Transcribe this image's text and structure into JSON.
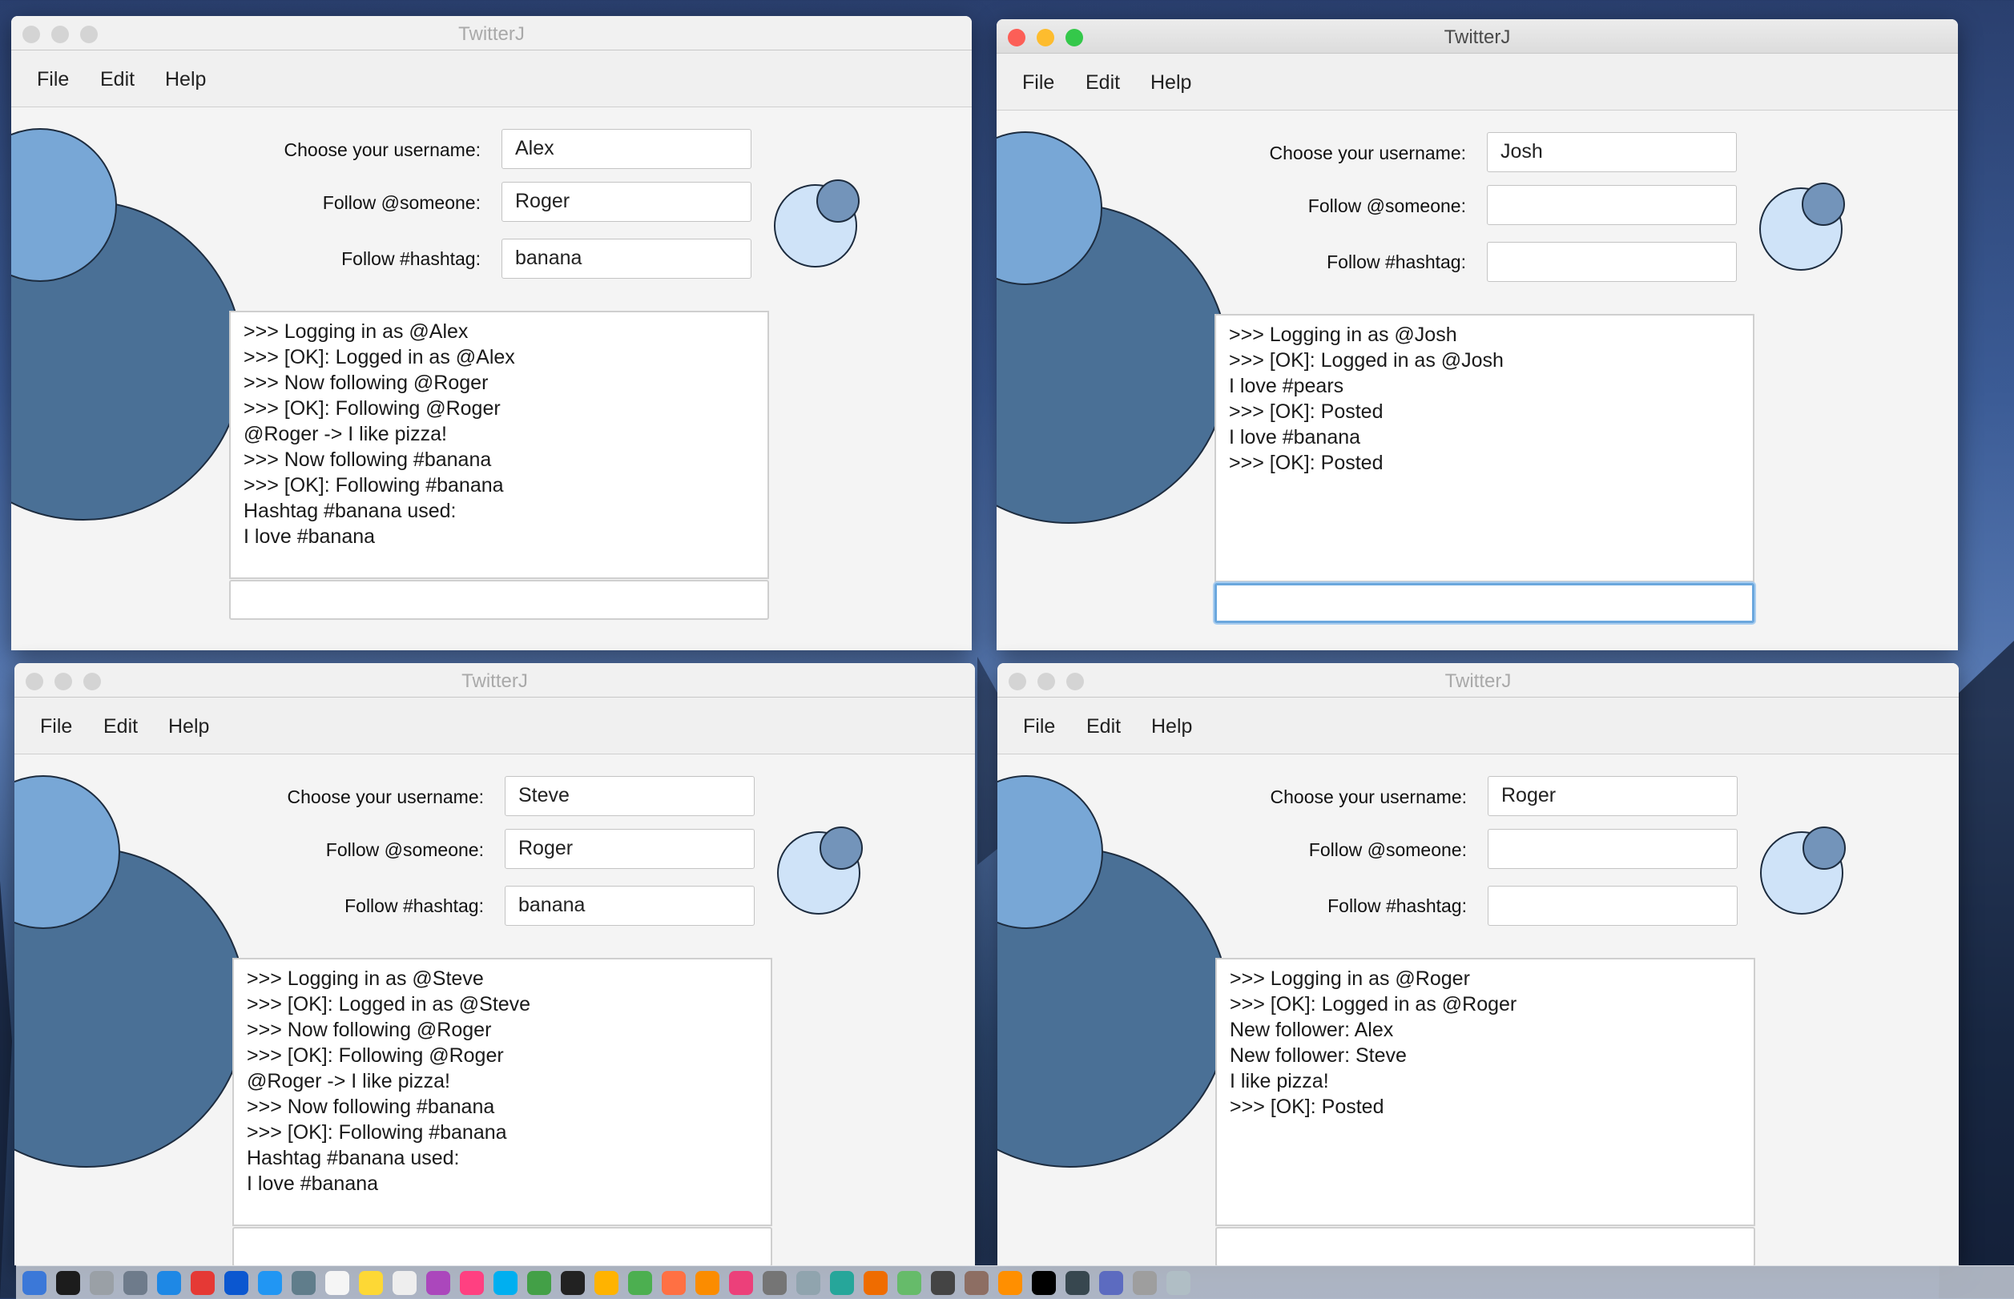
{
  "windows": [
    {
      "id": "alex",
      "title": "TwitterJ",
      "active": false,
      "menu": [
        "File",
        "Edit",
        "Help"
      ],
      "labels": {
        "username": "Choose your username:",
        "follow_user": "Follow @someone:",
        "follow_tag": "Follow #hashtag:"
      },
      "fields": {
        "username": "Alex",
        "follow_user": "Roger",
        "follow_tag": "banana"
      },
      "log": [
        ">>> Logging in as @Alex",
        ">>> [OK]: Logged in as @Alex",
        ">>> Now following @Roger",
        ">>> [OK]: Following @Roger",
        "@Roger -> I like pizza!",
        ">>> Now following #banana",
        ">>> [OK]: Following #banana",
        "Hashtag #banana used:",
        "I love #banana"
      ],
      "message": ""
    },
    {
      "id": "josh",
      "title": "TwitterJ",
      "active": true,
      "menu": [
        "File",
        "Edit",
        "Help"
      ],
      "labels": {
        "username": "Choose your username:",
        "follow_user": "Follow @someone:",
        "follow_tag": "Follow #hashtag:"
      },
      "fields": {
        "username": "Josh",
        "follow_user": "",
        "follow_tag": ""
      },
      "log": [
        ">>> Logging in as @Josh",
        ">>> [OK]: Logged in as @Josh",
        "I love #pears",
        ">>> [OK]: Posted",
        "I love #banana",
        ">>> [OK]: Posted"
      ],
      "message": ""
    },
    {
      "id": "steve",
      "title": "TwitterJ",
      "active": false,
      "menu": [
        "File",
        "Edit",
        "Help"
      ],
      "labels": {
        "username": "Choose your username:",
        "follow_user": "Follow @someone:",
        "follow_tag": "Follow #hashtag:"
      },
      "fields": {
        "username": "Steve",
        "follow_user": "Roger",
        "follow_tag": "banana"
      },
      "log": [
        ">>> Logging in as @Steve",
        ">>> [OK]: Logged in as @Steve",
        ">>> Now following @Roger",
        ">>> [OK]: Following @Roger",
        "@Roger -> I like pizza!",
        ">>> Now following #banana",
        ">>> [OK]: Following #banana",
        "Hashtag #banana used:",
        "I love #banana"
      ],
      "message": ""
    },
    {
      "id": "roger",
      "title": "TwitterJ",
      "active": false,
      "menu": [
        "File",
        "Edit",
        "Help"
      ],
      "labels": {
        "username": "Choose your username:",
        "follow_user": "Follow @someone:",
        "follow_tag": "Follow #hashtag:"
      },
      "fields": {
        "username": "Roger",
        "follow_user": "",
        "follow_tag": ""
      },
      "log": [
        ">>> Logging in as @Roger",
        ">>> [OK]: Logged in as @Roger",
        "New follower: Alex",
        "New follower: Steve",
        "I like pizza!",
        ">>> [OK]: Posted"
      ],
      "message": ""
    }
  ],
  "colors": {
    "circle_large": "#4a7096",
    "circle_medium": "#78a7d6",
    "circle_pale": "#cfe3f8",
    "circle_small": "#7394ba",
    "close": "#fc5f57",
    "minimize": "#fdbc2e",
    "zoom": "#34c84a",
    "inactive_button": "#d4d4d4"
  },
  "dock": {
    "icons": [
      "finder-icon",
      "siri-icon",
      "launchpad-icon",
      "rocket-icon",
      "safari-icon",
      "chrome-icon",
      "firefox-icon",
      "appstore-icon",
      "preview-icon",
      "calendar-icon",
      "notes-icon",
      "reminders-icon",
      "photos-icon",
      "itunes-icon",
      "skype-icon",
      "messages-icon",
      "terminal-icon",
      "keynote-icon",
      "numbers-icon",
      "charts-icon",
      "ibooks-icon",
      "music-icon",
      "settings-icon",
      "app-icon",
      "vpn-icon",
      "java-icon",
      "wechat-icon",
      "ink-icon",
      "scanner-icon",
      "stage-icon",
      "idea-icon",
      "activity-icon",
      "window-icon",
      "folder-icon",
      "trash-icon"
    ]
  }
}
